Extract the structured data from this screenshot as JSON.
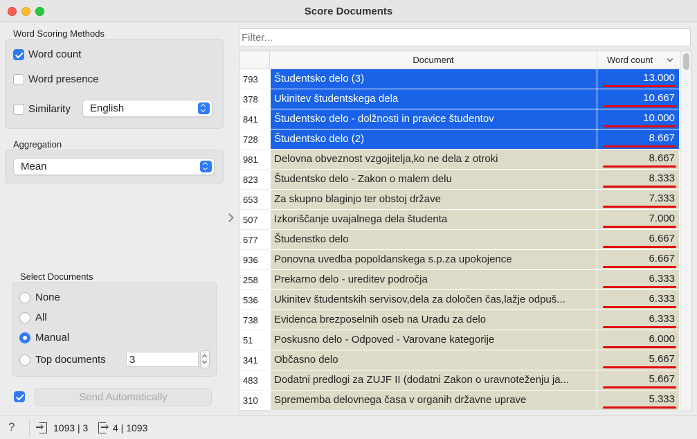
{
  "window": {
    "title": "Score Documents"
  },
  "word_scoring": {
    "group_title": "Word Scoring Methods",
    "word_count_label": "Word count",
    "word_count_checked": true,
    "word_presence_label": "Word presence",
    "word_presence_checked": false,
    "similarity_label": "Similarity",
    "similarity_checked": false,
    "language_selected": "English"
  },
  "aggregation": {
    "group_title": "Aggregation",
    "selected": "Mean"
  },
  "select_documents": {
    "group_title": "Select Documents",
    "options": [
      "None",
      "All",
      "Manual",
      "Top documents"
    ],
    "selected": "Manual",
    "top_documents_value": "3"
  },
  "send": {
    "auto_checked": true,
    "button_label": "Send Automatically"
  },
  "filter": {
    "placeholder": "Filter..."
  },
  "table": {
    "columns": {
      "document": "Document",
      "score": "Word count"
    },
    "rows": [
      {
        "index": "793",
        "document": "Študentsko delo (3)",
        "score": "13.000",
        "selected": true
      },
      {
        "index": "378",
        "document": "Ukinitev študentskega dela",
        "score": "10.667",
        "selected": true
      },
      {
        "index": "841",
        "document": "Študentsko delo - dolžnosti in pravice študentov",
        "score": "10.000",
        "selected": true
      },
      {
        "index": "728",
        "document": "Študentsko delo (2)",
        "score": "8.667",
        "selected": true
      },
      {
        "index": "981",
        "document": "Delovna obveznost vzgojitelja,ko ne dela z otroki",
        "score": "8.667",
        "selected": false
      },
      {
        "index": "823",
        "document": "Študentsko delo - Zakon o malem delu",
        "score": "8.333",
        "selected": false
      },
      {
        "index": "653",
        "document": "Za skupno blaginjo ter obstoj države",
        "score": "7.333",
        "selected": false
      },
      {
        "index": "507",
        "document": "Izkoriščanje uvajalnega dela študenta",
        "score": "7.000",
        "selected": false
      },
      {
        "index": "677",
        "document": "Študenstko delo",
        "score": "6.667",
        "selected": false
      },
      {
        "index": "936",
        "document": "Ponovna uvedba popoldanskega s.p.za upokojence",
        "score": "6.667",
        "selected": false
      },
      {
        "index": "258",
        "document": "Prekarno delo - ureditev področja",
        "score": "6.333",
        "selected": false
      },
      {
        "index": "536",
        "document": "Ukinitev študentskih servisov,dela za določen čas,lažje odpuš...",
        "score": "6.333",
        "selected": false
      },
      {
        "index": "738",
        "document": "Evidenca brezposelnih oseb na Uradu za delo",
        "score": "6.333",
        "selected": false
      },
      {
        "index": "51",
        "document": "Poskusno delo - Odpoved - Varovane kategorije",
        "score": "6.000",
        "selected": false
      },
      {
        "index": "341",
        "document": "Občasno delo",
        "score": "5.667",
        "selected": false
      },
      {
        "index": "483",
        "document": "Dodatni predlogi za ZUJF II (dodatni Zakon o uravnoteženju ja...",
        "score": "5.667",
        "selected": false
      },
      {
        "index": "310",
        "document": "Sprememba delovnega časa v organih državne uprave",
        "score": "5.333",
        "selected": false
      }
    ]
  },
  "status": {
    "input_summary": "1093 | 3",
    "output_summary": "4 | 1093"
  },
  "colors": {
    "selection": "#1a63e8",
    "row_bg": "#dddbc8",
    "accent": "#2f7cf6",
    "annotation_underline": "#e4070b"
  }
}
